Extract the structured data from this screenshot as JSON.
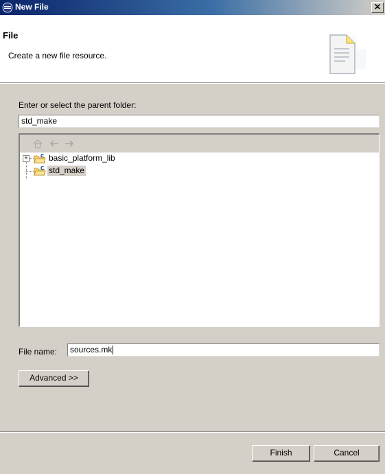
{
  "window": {
    "title": "New File",
    "close_glyph": "✕"
  },
  "header": {
    "title": "File",
    "description": "Create a new file resource.",
    "image_icon": "new-file-banner-icon"
  },
  "parent_folder": {
    "label": "Enter or select the parent folder:",
    "value": "std_make"
  },
  "tree": {
    "toolbar": {
      "home": "home-icon",
      "back": "back-arrow-icon",
      "forward": "forward-arrow-icon"
    },
    "items": [
      {
        "label": "basic_platform_lib",
        "expanded": false,
        "selected": false,
        "icon": "c-project-folder-icon"
      },
      {
        "label": "std_make",
        "expanded": false,
        "selected": true,
        "icon": "c-project-folder-icon"
      }
    ]
  },
  "file_name": {
    "label": "File name:",
    "value": "sources.mk"
  },
  "buttons": {
    "advanced": "Advanced >>",
    "finish": "Finish",
    "cancel": "Cancel"
  }
}
